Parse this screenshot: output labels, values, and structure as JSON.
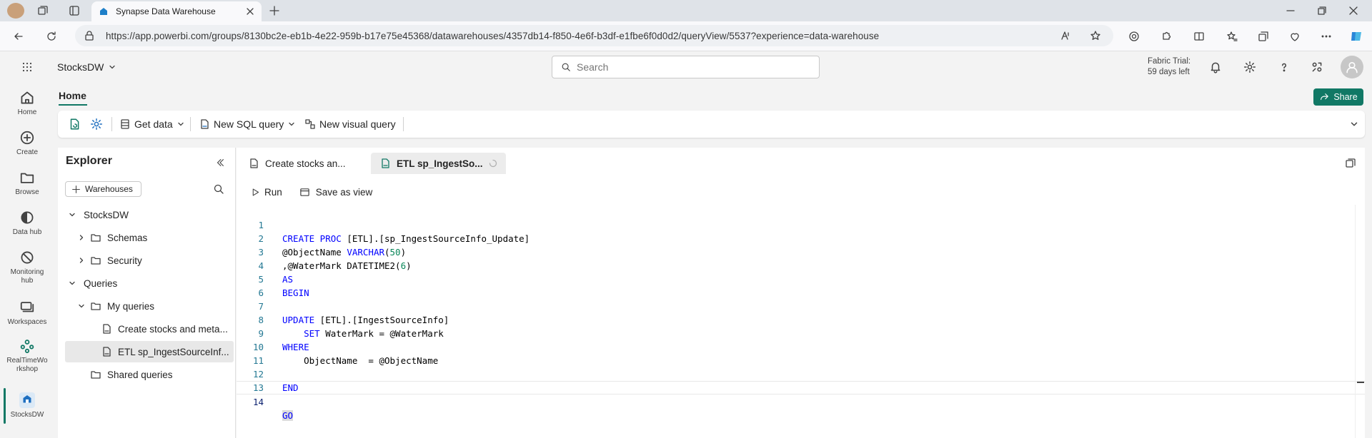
{
  "browser": {
    "tab_title": "Synapse Data Warehouse",
    "url": "https://app.powerbi.com/groups/8130bc2e-eb1b-4e22-959b-b17e75e45368/datawarehouses/4357db14-f850-4e6f-b3df-e1fbe6f0d0d2/queryView/5537?experience=data-warehouse"
  },
  "header": {
    "workspace_name": "StocksDW",
    "search_placeholder": "Search",
    "trial_line1": "Fabric Trial:",
    "trial_line2": "59 days left"
  },
  "rail": {
    "items": [
      {
        "label": "Home"
      },
      {
        "label": "Create"
      },
      {
        "label": "Browse"
      },
      {
        "label": "Data hub"
      },
      {
        "label": "Monitoring hub"
      },
      {
        "label": "Workspaces"
      },
      {
        "label": "RealTimeWorkshop"
      },
      {
        "label": "StocksDW"
      }
    ],
    "monitoring_l1": "Monitoring",
    "monitoring_l2": "hub",
    "rtw_l1": "RealTimeWo",
    "rtw_l2": "rkshop"
  },
  "ribbon": {
    "home_tab": "Home",
    "share": "Share",
    "get_data": "Get data",
    "new_sql_query": "New SQL query",
    "new_visual_query": "New visual query"
  },
  "explorer": {
    "title": "Explorer",
    "warehouses_button": "Warehouses",
    "tree": {
      "stocksdw": "StocksDW",
      "schemas": "Schemas",
      "security": "Security",
      "queries": "Queries",
      "my_queries": "My queries",
      "query1": "Create stocks and meta...",
      "query2": "ETL sp_IngestSourceInf...",
      "shared_queries": "Shared queries"
    }
  },
  "editor": {
    "tabs": [
      {
        "label": "Create stocks an..."
      },
      {
        "label": "ETL sp_IngestSo..."
      }
    ],
    "run": "Run",
    "save_as_view": "Save as view",
    "line_numbers": [
      "1",
      "2",
      "3",
      "4",
      "5",
      "6",
      "7",
      "8",
      "9",
      "10",
      "11",
      "12",
      "13",
      "14"
    ],
    "code": {
      "l1_kw": "CREATE PROC",
      "l1_rest": " [ETL].[sp_IngestSourceInfo_Update]",
      "l2_a": "@ObjectName ",
      "l2_kw": "VARCHAR",
      "l2_b": "(",
      "l2_num": "50",
      "l2_c": ")",
      "l3_a": ",@WaterMark DATETIME2(",
      "l3_num": "6",
      "l3_b": ")",
      "l4_kw": "AS",
      "l5_kw": "BEGIN",
      "l7_kw": "UPDATE",
      "l7_rest": " [ETL].[IngestSourceInfo]",
      "l8_indent": "    ",
      "l8_kw": "SET",
      "l8_rest": " WaterMark = @WaterMark",
      "l9_kw": "WHERE",
      "l10": "    ObjectName  = @ObjectName",
      "l12_kw": "END",
      "l14_kw": "GO"
    }
  },
  "colors": {
    "accent": "#117865",
    "keyword": "#0000ff",
    "number": "#098658",
    "line_number": "#237893"
  }
}
